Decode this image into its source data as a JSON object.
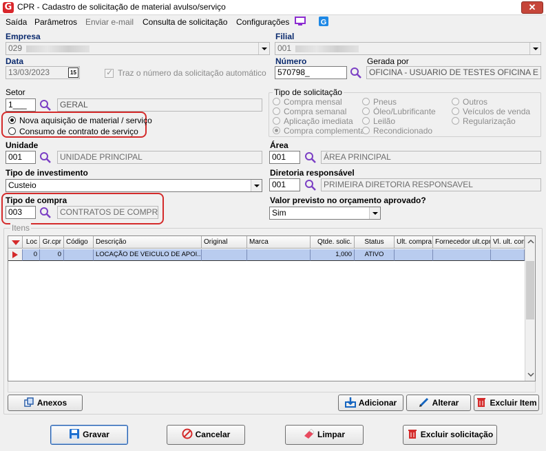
{
  "window": {
    "title": "CPR - Cadastro de solicitação de material avulso/serviço",
    "close_glyph": "✕",
    "app_icon": "G"
  },
  "menu": {
    "items": [
      "Saída",
      "Parâmetros",
      "Enviar e-mail",
      "Consulta de solicitação",
      "Configurações"
    ],
    "disabled": [
      "Enviar e-mail"
    ],
    "icons": [
      "monitor-icon",
      "g-app-icon"
    ]
  },
  "empresa": {
    "label": "Empresa",
    "value": "029"
  },
  "filial": {
    "label": "Filial",
    "value": "001"
  },
  "data": {
    "label": "Data",
    "value": "13/03/2023",
    "calendar_glyph": "15"
  },
  "checkbox": {
    "label": "Traz o número da solicitação automático",
    "checked": true
  },
  "numero": {
    "label": "Número",
    "value": "570798_"
  },
  "gerada_por": {
    "label": "Gerada por",
    "value": "OFICINA - USUARIO DE TESTES OFICINA E MATE"
  },
  "setor": {
    "label": "Setor",
    "code": "1___",
    "name": "GERAL"
  },
  "modalidade": {
    "options": [
      "Nova aquisição de material / serviço",
      "Consumo de contrato de serviço"
    ],
    "selected": 0
  },
  "tipo_solicitacao": {
    "title": "Tipo de solicitação",
    "options": [
      "Compra mensal",
      "Compra semanal",
      "Aplicação imediata",
      "Compra complementar",
      "Pneus",
      "Óleo/Lubrificante",
      "Leilão",
      "Recondicionado",
      "Outros",
      "Veículos de venda",
      "Regularização"
    ],
    "selected": "Compra complementar"
  },
  "unidade": {
    "label": "Unidade",
    "code": "001",
    "name": "UNIDADE PRINCIPAL"
  },
  "area": {
    "label": "Área",
    "code": "001",
    "name": "ÁREA PRINCIPAL"
  },
  "tipo_investimento": {
    "label": "Tipo de investimento",
    "value": "Custeio"
  },
  "diretoria": {
    "label": "Diretoria responsável",
    "code": "001",
    "name": "PRIMEIRA DIRETORIA RESPONSAVEL"
  },
  "tipo_compra": {
    "label": "Tipo de compra",
    "code": "003",
    "name": "CONTRATOS DE COMPRA"
  },
  "valor_previsto": {
    "label": "Valor previsto no orçamento aprovado?",
    "value": "Sim"
  },
  "itens": {
    "title": "Itens",
    "columns": [
      "",
      "Loc",
      "Gr.cpr",
      "Código",
      "Descrição",
      "Original",
      "Marca",
      "Qtde. solic.",
      "Status",
      "Ult. compra",
      "Fornecedor ult.cpr",
      "Vl. ult. com"
    ],
    "rows": [
      {
        "loc": "0",
        "grcpr": "0",
        "codigo": "",
        "descricao": "LOCAÇÃO DE VEICULO DE APOI...",
        "original": "",
        "marca": "",
        "qtde": "1,000",
        "status": "ATIVO",
        "ult_compra": "",
        "fornecedor": "",
        "vl_ult": ""
      }
    ]
  },
  "item_buttons": {
    "anexos": "Anexos",
    "adicionar": "Adicionar",
    "alterar": "Alterar",
    "excluir_item": "Excluir Item"
  },
  "footer_buttons": {
    "gravar": "Gravar",
    "cancelar": "Cancelar",
    "limpar": "Limpar",
    "excluir_solicitacao": "Excluir solicitação"
  },
  "colors": {
    "label_blue": "#0a2a6e",
    "highlight_red": "#d42a2a",
    "row_selected": "#b9ccef",
    "lookup_purple": "#7b3fc4"
  }
}
